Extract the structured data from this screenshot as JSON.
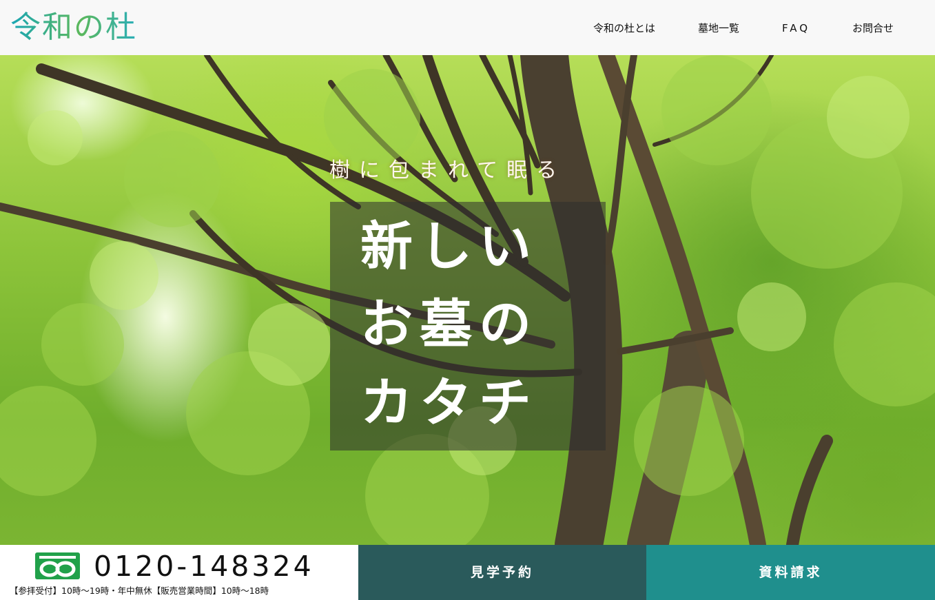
{
  "header": {
    "logo_text": "令和の杜",
    "nav": [
      {
        "label": "令和の杜とは"
      },
      {
        "label": "墓地一覧"
      },
      {
        "label": "FAQ"
      },
      {
        "label": "お問合せ"
      }
    ]
  },
  "hero": {
    "tagline": "樹に包まれて眠る",
    "headline_lines": [
      "新しい",
      "お墓の",
      "カタチ"
    ],
    "background": "tree-canopy-photo"
  },
  "footer_bar": {
    "freedial_icon": "freedial-icon",
    "phone_number": "0120-148324",
    "hours_text": "【参拝受付】10時〜19時・年中無休【販売営業時間】10時〜18時",
    "visit_button_label": "見学予約",
    "docs_button_label": "資料請求"
  },
  "colors": {
    "logo_teal": "#1aa6b5",
    "logo_green": "#5cb85c",
    "visit_button_bg": "#2a5a5b",
    "docs_button_bg": "#1f8f8d",
    "freedial_green": "#21a14a"
  }
}
